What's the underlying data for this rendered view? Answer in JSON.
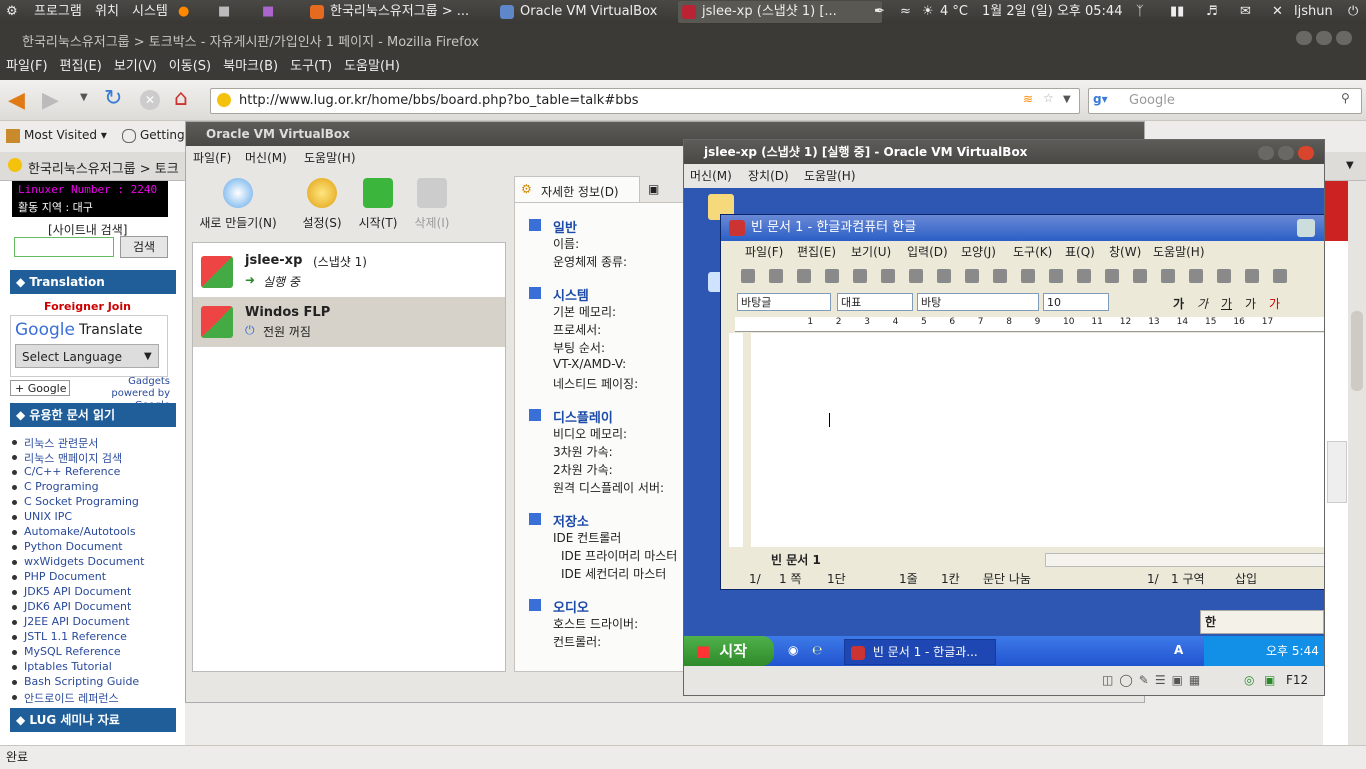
{
  "panel": {
    "apps": "프로그램",
    "places": "위치",
    "system": "시스템",
    "tasks": [
      {
        "label": "한국리눅스유저그룹 > ..."
      },
      {
        "label": "Oracle VM VirtualBox"
      },
      {
        "label": "jslee-xp (스냅샷 1) [..."
      }
    ],
    "weather": "4 °C",
    "datetime": "1월 2일 (일) 오후 05:44",
    "user": "ljshun"
  },
  "firefox": {
    "title": "한국리눅스유저그룹 > 토크박스 - 자유게시판/가입인사 1 페이지 - Mozilla Firefox",
    "menu": [
      "파일(F)",
      "편집(E)",
      "보기(V)",
      "이동(S)",
      "북마크(B)",
      "도구(T)",
      "도움말(H)"
    ],
    "url": "http://www.lug.or.kr/home/bbs/board.php?bo_table=talk#bbs",
    "search_placeholder": "Google",
    "bookmarks": [
      "Most Visited ▾",
      "Getting St"
    ],
    "tab_label": "한국리눅스유저그룹 > 토크",
    "status": "완료"
  },
  "sidebar": {
    "linuxer": "Linuxer Number : 2240",
    "region": "활동 지역 : 대구",
    "site_search_label": "[사이트내 검색]",
    "search_button": "검색",
    "translation_title": "◆ Translation",
    "foreigner_join": "Foreigner Join",
    "translate_label": "Translate",
    "select_language": "Select Language",
    "gadgets_text": "Gadgets powered by Google",
    "docs_title": "◆ 유용한 문서 읽기",
    "docs": [
      "리눅스 관련문서",
      "리눅스 맨페이지 검색",
      "C/C++ Reference",
      "C Programing",
      "C Socket Programing",
      "UNIX IPC",
      "Automake/Autotools",
      "Python Document",
      "wxWidgets Document",
      "PHP Document",
      "JDK5 API Document",
      "JDK6 API Document",
      "J2EE API Document",
      "JSTL 1.1 Reference",
      "MySQL Reference",
      "Iptables Tutorial",
      "Bash Scripting Guide",
      "안드로이드 레퍼런스"
    ],
    "seminar_title": "◆ LUG 세미나 자료"
  },
  "vbox_manager": {
    "title": "Oracle VM VirtualBox",
    "menu": [
      "파일(F)",
      "머신(M)",
      "도움말(H)"
    ],
    "tools": [
      "새로 만들기(N)",
      "설정(S)",
      "시작(T)",
      "삭제(I)"
    ],
    "vms": [
      {
        "name": "jslee-xp",
        "snapshot": "(스냅샷 1)",
        "state": "실행 중"
      },
      {
        "name": "Windos FLP",
        "snapshot": "",
        "state": "전원 꺼짐"
      }
    ],
    "details_tab": "자세한 정보(D)",
    "sections": [
      {
        "title": "일반",
        "rows": [
          "이름:",
          "운영체제 종류:"
        ]
      },
      {
        "title": "시스템",
        "rows": [
          "기본 메모리:",
          "프로세서:",
          "부팅 순서:",
          "VT-X/AMD-V:",
          "네스티드 페이징:"
        ]
      },
      {
        "title": "디스플레이",
        "rows": [
          "비디오 메모리:",
          "3차원 가속:",
          "2차원 가속:",
          "원격 디스플레이 서버:"
        ]
      },
      {
        "title": "저장소",
        "rows": [
          "IDE 컨트롤러",
          "IDE 프라이머리 마스터",
          "IDE 세컨더리 마스터"
        ]
      },
      {
        "title": "오디오",
        "rows": [
          "호스트 드라이버:",
          "컨트롤러:"
        ]
      }
    ]
  },
  "vm_window": {
    "title": "jslee-xp (스냅샷 1) [실행 중] - Oracle VM VirtualBox",
    "menu": [
      "머신(M)",
      "장치(D)",
      "도움말(H)"
    ],
    "status_key": "F12"
  },
  "hwp": {
    "title": "빈 문서 1 - 한글과컴퓨터 한글",
    "menu": [
      "파일(F)",
      "편집(E)",
      "보기(U)",
      "입력(D)",
      "모양(J)",
      "도구(K)",
      "표(Q)",
      "창(W)",
      "도움말(H)"
    ],
    "style": "바탕글",
    "font_group": "대표",
    "font": "바탕",
    "size": "10",
    "doc_tab": "빈 문서 1",
    "status": [
      "1/",
      "1 쪽",
      "1단",
      "1줄",
      "1칸",
      "문단 나눔",
      "1/",
      "1 구역",
      "삽입"
    ]
  },
  "xp": {
    "start": "시작",
    "task": "빈 문서 1 - 한글과...",
    "ime": "한",
    "clock": "오후 5:44"
  },
  "colors": {
    "panel": "#3c3b37",
    "accent_blue": "#1f5e99",
    "xp_blue": "#2d57b3"
  }
}
